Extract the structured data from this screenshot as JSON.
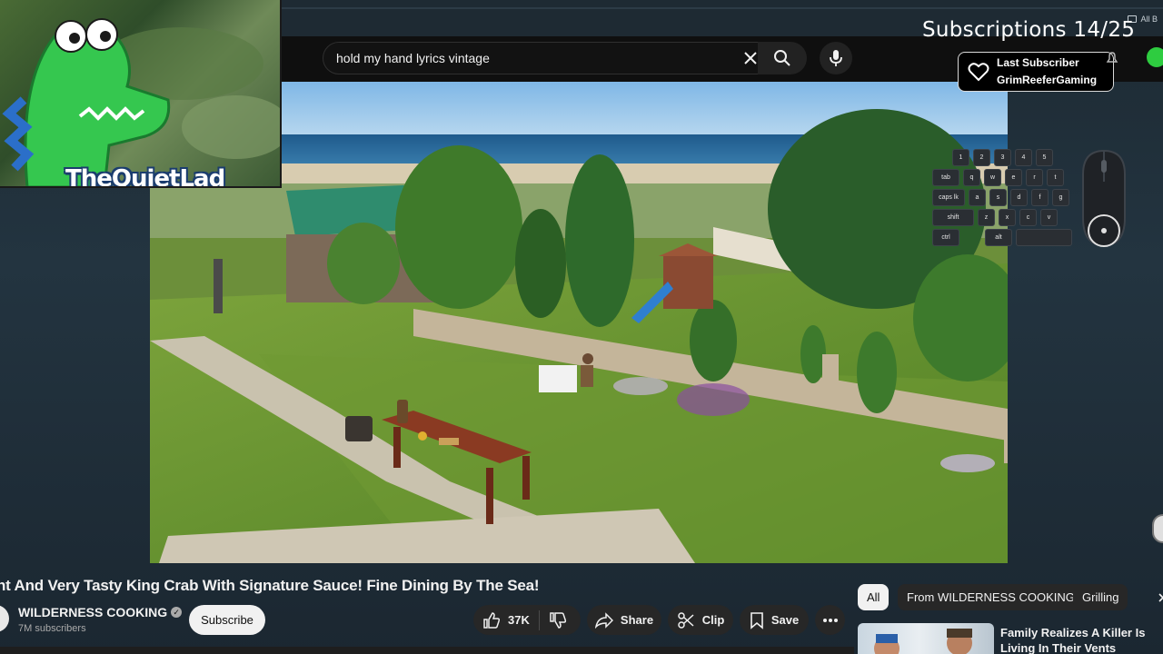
{
  "browser": {
    "bookmarks_label": "All B"
  },
  "search": {
    "query": "hold my hand lyrics vintage"
  },
  "overlay": {
    "streamer_name": "TheQuietLad",
    "subscription_goal": "Subscriptions 14/25",
    "last_subscriber_label": "Last Subscriber",
    "last_subscriber_name": "GrimReeferGaming",
    "keys": {
      "row1": [
        "1",
        "2",
        "3",
        "4",
        "5"
      ],
      "row2": [
        "tab",
        "q",
        "w",
        "e",
        "r",
        "t"
      ],
      "row3": [
        "caps lk",
        "a",
        "s",
        "d",
        "f",
        "g"
      ],
      "row4": [
        "shift",
        "z",
        "x",
        "c",
        "v"
      ],
      "row5": [
        "ctrl",
        "alt"
      ]
    }
  },
  "video": {
    "title": "nt And Very Tasty King Crab With Signature Sauce! Fine Dining By The Sea!",
    "channel_name": "WILDERNESS COOKING",
    "channel_subscribers": "7M subscribers",
    "subscribe_label": "Subscribe",
    "like_count": "37K",
    "share_label": "Share",
    "clip_label": "Clip",
    "save_label": "Save"
  },
  "chips": [
    "All",
    "From WILDERNESS COOKING",
    "Grilling"
  ],
  "recommendation": {
    "title": "Family Realizes A Killer Is Living In Their Vents"
  },
  "colors": {
    "youtube_bg": "#0f0f0f",
    "chip_bg": "#272727",
    "stream_bg": "#1d2a33",
    "streamer_name_outline": "#1b3d6e",
    "status_green": "#2ecc40"
  }
}
